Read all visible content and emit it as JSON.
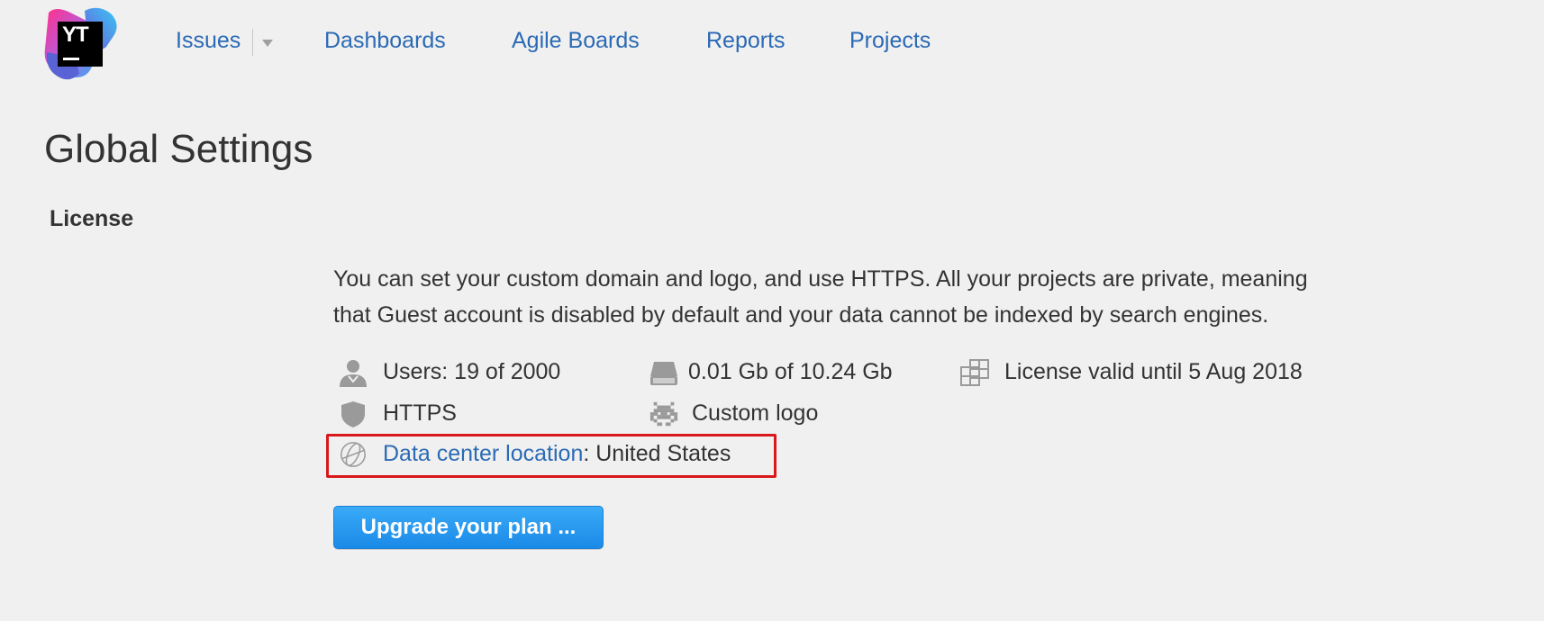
{
  "logo": {
    "text": "YT",
    "icon": "youtrack-logo-icon"
  },
  "nav": {
    "items": [
      {
        "label": "Issues"
      },
      {
        "label": "Dashboards"
      },
      {
        "label": "Agile Boards"
      },
      {
        "label": "Reports"
      },
      {
        "label": "Projects"
      }
    ]
  },
  "page": {
    "title": "Global Settings"
  },
  "license": {
    "section_title": "License",
    "description_line1": "You can set your custom domain and logo, and use HTTPS. All your projects are private, meaning",
    "description_line2": "that Guest account is disabled by default and your data cannot be indexed by search engines.",
    "users": {
      "icon": "user-icon",
      "text": "Users: 19 of 2000"
    },
    "storage": {
      "icon": "storage-drive-icon",
      "text": "0.01 Gb of 10.24 Gb"
    },
    "validity": {
      "icon": "license-grid-icon",
      "text": "License valid until 5 Aug 2018"
    },
    "https": {
      "icon": "shield-icon",
      "text": "HTTPS"
    },
    "custom_logo": {
      "icon": "space-invader-icon",
      "text": "Custom logo"
    },
    "data_center": {
      "icon": "globe-icon",
      "link_text": "Data center location",
      "value_text": ": United States"
    },
    "upgrade_button": "Upgrade your plan ..."
  },
  "colors": {
    "background": "#f0f0f0",
    "link": "#2b6ab5",
    "highlight": "#d9181c",
    "button": "#1a8ae8"
  }
}
